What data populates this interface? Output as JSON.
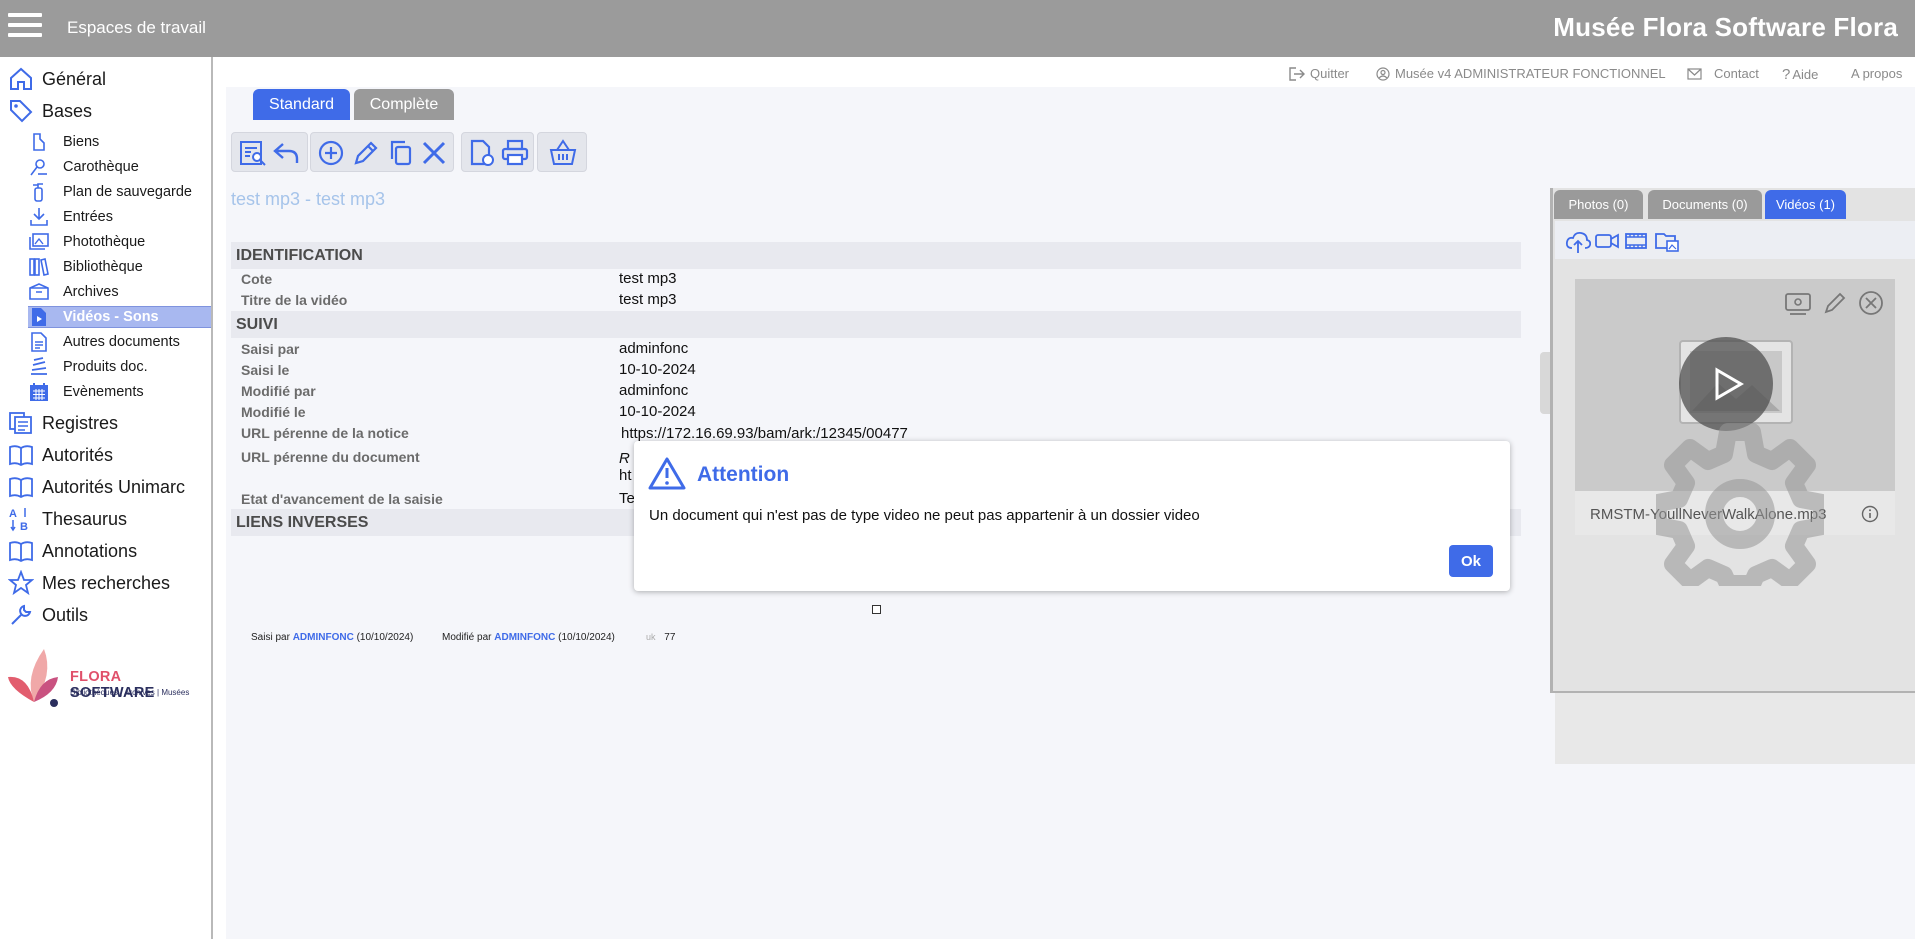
{
  "topbar": {
    "workspaces": "Espaces de travail",
    "brand": "Musée Flora Software Flora"
  },
  "sidebar": {
    "items": [
      {
        "label": "Général",
        "icon": "home-icon"
      },
      {
        "label": "Bases",
        "icon": "tag-icon"
      },
      {
        "label": "Registres",
        "icon": "registers-icon"
      },
      {
        "label": "Autorités",
        "icon": "book-icon"
      },
      {
        "label": "Autorités Unimarc",
        "icon": "book-icon"
      },
      {
        "label": "Thesaurus",
        "icon": "sort-az-icon"
      },
      {
        "label": "Annotations",
        "icon": "book-icon"
      },
      {
        "label": "Mes recherches",
        "icon": "star-icon"
      },
      {
        "label": "Outils",
        "icon": "wrench-icon"
      }
    ],
    "sub_items": [
      {
        "label": "Biens",
        "icon": "item-icon"
      },
      {
        "label": "Carothèque",
        "icon": "map-pin-icon"
      },
      {
        "label": "Plan de sauvegarde",
        "icon": "extinguisher-icon"
      },
      {
        "label": "Entrées",
        "icon": "download-icon"
      },
      {
        "label": "Photothèque",
        "icon": "images-icon"
      },
      {
        "label": "Bibliothèque",
        "icon": "books-icon"
      },
      {
        "label": "Archives",
        "icon": "archive-box-icon"
      },
      {
        "label": "Vidéos - Sons",
        "icon": "video-file-icon"
      },
      {
        "label": "Autres documents",
        "icon": "document-icon"
      },
      {
        "label": "Produits doc.",
        "icon": "stack-icon"
      },
      {
        "label": "Evènements",
        "icon": "calendar-icon"
      }
    ],
    "logo": {
      "name_part1": "FLORA",
      "name_part2": " SOFTWARE",
      "tagline": "Bibliothèques | Archives | Musées"
    }
  },
  "topnav": {
    "quit": "Quitter",
    "user": "Musée v4 ADMINISTRATEUR FONCTIONNEL",
    "contact": "Contact",
    "help": "Aide",
    "about": "A propos"
  },
  "tabs": {
    "standard": "Standard",
    "complete": "Complète"
  },
  "record": {
    "title": "test mp3 - test mp3",
    "sections": {
      "identification": "IDENTIFICATION",
      "suivi": "SUIVI",
      "liens": "LIENS INVERSES"
    },
    "fields": {
      "cote": {
        "label": "Cote",
        "value": "test mp3"
      },
      "titre": {
        "label": "Titre de la vidéo",
        "value": "test mp3"
      },
      "saisi_par": {
        "label": "Saisi par",
        "value": "adminfonc"
      },
      "saisi_le": {
        "label": "Saisi le",
        "value": "10-10-2024"
      },
      "modifie_par": {
        "label": "Modifié par",
        "value": "adminfonc"
      },
      "modifie_le": {
        "label": "Modifié le",
        "value": "10-10-2024"
      },
      "url_notice": {
        "label": "URL pérenne de la notice",
        "value": "https://172.16.69.93/bam/ark:/12345/00477"
      },
      "url_document": {
        "label": "URL pérenne du document",
        "value_line1": "R",
        "value_line2": "ht"
      },
      "etat": {
        "label": "Etat d'avancement de la saisie",
        "value": "Te"
      }
    }
  },
  "footer": {
    "saisi_prefix": "Saisi par",
    "saisi_user": "ADMINFONC",
    "saisi_date": "(10/10/2024)",
    "modifie_prefix": "Modifié par",
    "modifie_user": "ADMINFONC",
    "modifie_date": "(10/10/2024)",
    "uk_label": "uk",
    "uk_value": "77"
  },
  "media": {
    "tabs": {
      "photos": "Photos (0)",
      "documents": "Documents (0)",
      "videos": "Vidéos (1)"
    },
    "file_name": "RMSTM-YoullNeverWalkAlone.mp3"
  },
  "dialog": {
    "title": "Attention",
    "message": "Un document qui n'est pas de type video ne peut pas appartenir à un dossier video",
    "ok": "Ok"
  },
  "colors": {
    "accent": "#3f6be8",
    "topbar": "#9b9b9b",
    "active_sub": "#a8b8f0"
  }
}
